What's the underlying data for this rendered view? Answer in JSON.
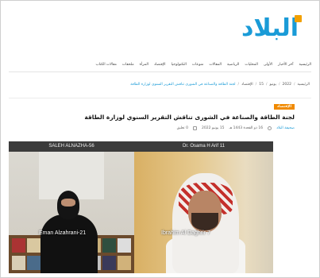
{
  "site": {
    "logo_text": "البلاد",
    "logo_color": "#1a9bd7"
  },
  "nav": {
    "items": [
      "الرئيسية",
      "آخر الأخبار",
      "الأولى",
      "المحليات",
      "الرياضية",
      "المقالات",
      "منوعات",
      "التكنولوجيا",
      "الإقتصاد",
      "المرأة",
      "ملحقات",
      "مقالات الكتاب"
    ]
  },
  "breadcrumb": {
    "home": "الرئيسية",
    "year": "2022",
    "month": "يونيو",
    "day": "15",
    "section": "الإقتصاد",
    "current": "لجنة الطاقة والصناعة في الشورى تناقش التقرير السنوي لوزارة الطاقة"
  },
  "article": {
    "category": "الإقتصاد",
    "title": "لجنة الطاقة والصناعة في الشورى تناقش التقرير السنوي لوزارة الطاقة",
    "author": "صحيفة البلاد",
    "hijri_date": "16 ذو القعدة 1443 هـ",
    "gregorian_date": "15 يونيو 2022",
    "comments": "0 تعليق"
  },
  "photo": {
    "left_header": "SALEH ALNAZHA-56",
    "right_header": "Dr. Osama H Arif 11",
    "left_name": "Eman Alzahrani-21",
    "right_name": "Ibrahim Al Daghrir 7"
  }
}
